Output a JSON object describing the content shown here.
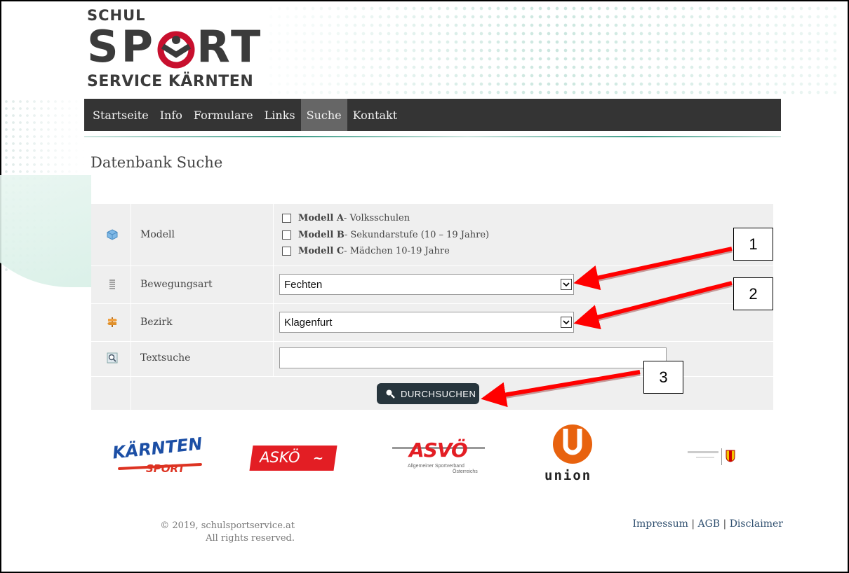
{
  "logo": {
    "line1": "SCHUL",
    "line2a": "SP",
    "line2b": "RT",
    "line3": "SERVICE KÄRNTEN"
  },
  "nav": {
    "items": [
      "Startseite",
      "Info",
      "Formulare",
      "Links",
      "Suche",
      "Kontakt"
    ],
    "active": "Suche"
  },
  "page": {
    "title": "Datenbank Suche"
  },
  "form": {
    "modell": {
      "label": "Modell",
      "options": [
        {
          "name": "Modell A",
          "desc": " - Volksschulen",
          "checked": false
        },
        {
          "name": "Modell B",
          "desc": " - Sekundarstufe (10 – 19 Jahre)",
          "checked": false
        },
        {
          "name": "Modell C",
          "desc": " - Mädchen 10-19 Jahre",
          "checked": false
        }
      ]
    },
    "bewegungsart": {
      "label": "Bewegungsart",
      "value": "Fechten"
    },
    "bezirk": {
      "label": "Bezirk",
      "value": "Klagenfurt"
    },
    "textsuche": {
      "label": "Textsuche",
      "value": ""
    },
    "submit_label": "DURCHSUCHEN"
  },
  "annotations": [
    "1",
    "2",
    "3"
  ],
  "sponsors": {
    "kaernten_a": "KÄRNTEN",
    "kaernten_b": "SPORT",
    "askoe": "ASKÖ",
    "asvoe": "ASVÖ",
    "asvoe_sub1": "Allgemeiner Sportverband",
    "asvoe_sub2": "Österreichs",
    "union": "union"
  },
  "footer": {
    "copyright_line1": "© 2019, schulsportservice.at",
    "copyright_line2": "All rights reserved.",
    "links": [
      "Impressum",
      "AGB",
      "Disclaimer"
    ],
    "separator": "|"
  },
  "colors": {
    "nav_bg": "#343434",
    "nav_active": "#666666",
    "accent_red": "#c8102e",
    "button_bg": "#27353d",
    "annotation_arrow": "#ff0000"
  }
}
